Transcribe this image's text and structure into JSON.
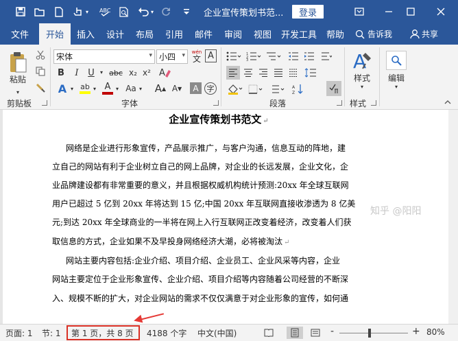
{
  "window": {
    "title": "企业宣传策划书范...",
    "login_label": "登录"
  },
  "tabs": [
    "文件",
    "开始",
    "插入",
    "设计",
    "布局",
    "引用",
    "邮件",
    "审阅",
    "视图",
    "开发工具",
    "帮助"
  ],
  "tell_me": "告诉我",
  "share": "共享",
  "ribbon": {
    "clipboard": {
      "paste_label": "粘贴",
      "group_label": "剪贴板"
    },
    "font": {
      "font_name": "宋体",
      "font_size": "小四",
      "wen_label": "wén",
      "wen_char": "文",
      "bold": "B",
      "italic": "I",
      "underline": "U",
      "strike": "abc",
      "subscript": "x₂",
      "superscript": "x²",
      "text_effects": "A",
      "grow": "A",
      "shrink": "A",
      "aa_label": "Aa",
      "char_border": "A",
      "font_color": "A",
      "highlight": "ab",
      "group_label": "字体"
    },
    "paragraph": {
      "group_label": "段落"
    },
    "styles": {
      "styles_label": "样式",
      "group_label": "样式"
    },
    "editing": {
      "editing_label": "编辑"
    },
    "colors": {
      "accent": "#2b579a",
      "font_red": "#c00000",
      "highlight_yellow": "#ffff00"
    }
  },
  "document": {
    "heading": "企业宣传策划书范文",
    "lines": [
      "网络是企业进行形象宣传，产品展示推广，与客户沟通，信息互动的阵地，建",
      "立自己的网站有利于企业树立自己的网上品牌，对企业的长远发展，企业文化，企",
      "业品牌建设都有非常重要的意义，并且根据权威机构统计预测:20xx 年全球互联网",
      "用户已超过 5 亿到 20xx 年将达到 15 亿;中国 20xx 年互联网直接收渗透为 8 亿美",
      "元;到达 20xx 年全球商业的一半将在网上入行互联网正改变着经济，改变着人们获",
      "取信息的方式，企业如果不及早投身网络经济大潮，必将被淘汰",
      "网站主要内容包括:企业介绍、项目介绍、企业员工、企业风采等内容，企业",
      "网站主要定位于企业形象宣传、企业介绍、项目介绍等内容随着公司经营的不断深",
      "入、规模不断的扩大，对企业网站的需求不仅仅满意于对企业形象的宣传，如何通"
    ]
  },
  "watermark": "知乎 @阳阳",
  "status": {
    "page_label": "页面: 1",
    "section_label": "节: 1",
    "page_count": "第 1 页，共 8 页",
    "word_count": "4188 个字",
    "language": "中文(中国)",
    "zoom_minus": "-",
    "zoom_plus": "+",
    "zoom_level": "80%"
  }
}
